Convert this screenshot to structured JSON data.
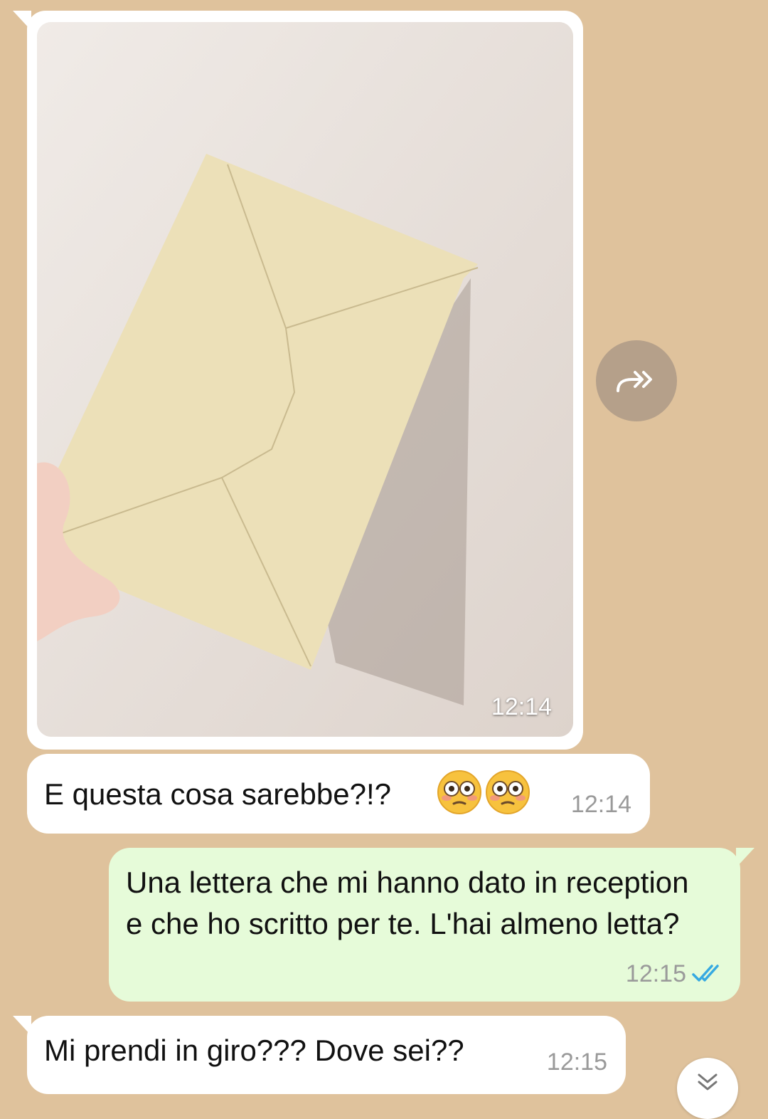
{
  "messages": [
    {
      "type": "image",
      "direction": "incoming",
      "time": "12:14",
      "image_icon": "envelope-photo"
    },
    {
      "type": "text",
      "direction": "incoming",
      "text": "E questa cosa sarebbe?!?",
      "emoji": [
        "😳",
        "😳"
      ],
      "time": "12:14"
    },
    {
      "type": "text",
      "direction": "outgoing",
      "text": "Una lettera che mi hanno dato in reception e che ho scritto per te. L'hai almeno letta?",
      "time": "12:15",
      "status": "read"
    },
    {
      "type": "text",
      "direction": "incoming",
      "text": "Mi prendi in giro??? Dove sei??",
      "time": "12:15"
    }
  ],
  "icons": {
    "forward": "forward-icon",
    "read_ticks": "double-check-icon",
    "scroll": "chevron-double-down-icon"
  },
  "colors": {
    "background": "#dfc29c",
    "incoming_bubble": "#ffffff",
    "outgoing_bubble": "#e6fbd9",
    "read_ticks": "#36a9e1",
    "forward_button": "#b5a08a"
  }
}
